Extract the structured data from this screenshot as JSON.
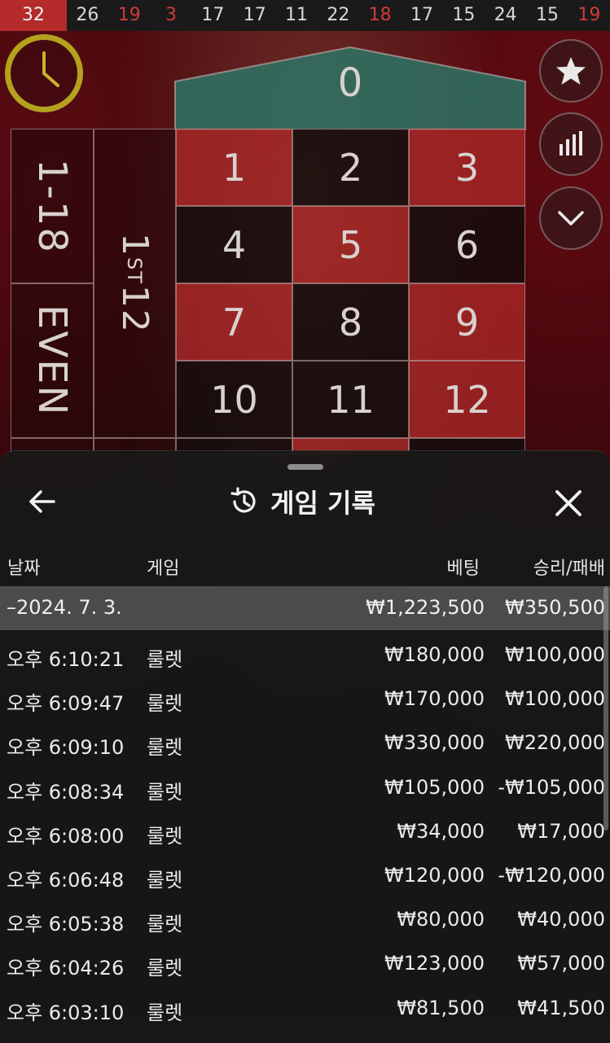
{
  "recent_numbers": [
    {
      "value": "32",
      "color": "red",
      "current": true
    },
    {
      "value": "26",
      "color": "black"
    },
    {
      "value": "19",
      "color": "red"
    },
    {
      "value": "3",
      "color": "red"
    },
    {
      "value": "17",
      "color": "black"
    },
    {
      "value": "17",
      "color": "black"
    },
    {
      "value": "11",
      "color": "black"
    },
    {
      "value": "22",
      "color": "black"
    },
    {
      "value": "18",
      "color": "red"
    },
    {
      "value": "17",
      "color": "black"
    },
    {
      "value": "15",
      "color": "black"
    },
    {
      "value": "24",
      "color": "black"
    },
    {
      "value": "15",
      "color": "black"
    },
    {
      "value": "19",
      "color": "red"
    }
  ],
  "table": {
    "zero": "0",
    "low_bet": "1-18",
    "even_bet": "EVEN",
    "dozen_num": "1",
    "dozen_sup": "ST",
    "dozen_rest": "12",
    "numbers": [
      [
        "1",
        "2",
        "3"
      ],
      [
        "4",
        "5",
        "6"
      ],
      [
        "7",
        "8",
        "9"
      ],
      [
        "10",
        "11",
        "12"
      ]
    ],
    "colors": [
      [
        "red",
        "black",
        "red"
      ],
      [
        "black",
        "red",
        "black"
      ],
      [
        "red",
        "black",
        "red"
      ],
      [
        "black",
        "black",
        "red"
      ]
    ]
  },
  "buttons": {
    "favorite_icon": "star-icon",
    "stats_icon": "bar-chart-icon",
    "collapse_icon": "chevron-down-icon"
  },
  "panel": {
    "title": "게임 기록",
    "columns": {
      "date": "날짜",
      "game": "게임",
      "bet": "베팅",
      "result": "승리/패배"
    },
    "day_summary": {
      "date": "–2024. 7. 3.",
      "bet": "₩1,223,500",
      "result": "₩350,500"
    },
    "rows": [
      {
        "time": "오후 6:10:21",
        "game": "룰렛",
        "bet": "₩180,000",
        "result": "₩100,000"
      },
      {
        "time": "오후 6:09:47",
        "game": "룰렛",
        "bet": "₩170,000",
        "result": "₩100,000"
      },
      {
        "time": "오후 6:09:10",
        "game": "룰렛",
        "bet": "₩330,000",
        "result": "₩220,000"
      },
      {
        "time": "오후 6:08:34",
        "game": "룰렛",
        "bet": "₩105,000",
        "result": "-₩105,000"
      },
      {
        "time": "오후 6:08:00",
        "game": "룰렛",
        "bet": "₩34,000",
        "result": "₩17,000"
      },
      {
        "time": "오후 6:06:48",
        "game": "룰렛",
        "bet": "₩120,000",
        "result": "-₩120,000"
      },
      {
        "time": "오후 6:05:38",
        "game": "룰렛",
        "bet": "₩80,000",
        "result": "₩40,000"
      },
      {
        "time": "오후 6:04:26",
        "game": "룰렛",
        "bet": "₩123,000",
        "result": "₩57,000"
      },
      {
        "time": "오후 6:03:10",
        "game": "룰렛",
        "bet": "₩81,500",
        "result": "₩41,500"
      }
    ]
  },
  "colors": {
    "red_number": "#d23a3a",
    "current_number_bg": "#b52b2b",
    "zero_green": "#2f7a6c",
    "timer_ring": "#b4a21e"
  }
}
